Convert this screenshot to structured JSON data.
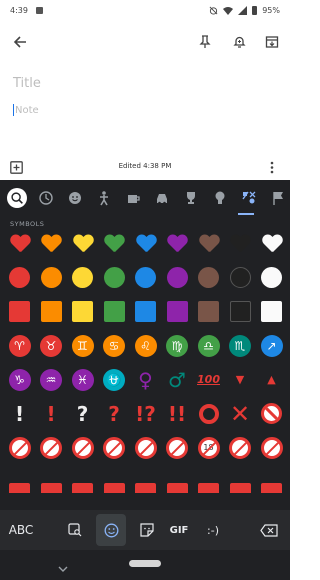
{
  "status_bar": {
    "time": "4:39",
    "battery": "95%"
  },
  "note": {
    "title_placeholder": "Title",
    "note_placeholder": "Note",
    "edited": "Edited 4:38 PM"
  },
  "keyboard": {
    "section_title": "SYMBOLS",
    "tools": {
      "abc": "ABC",
      "gif": "GIF",
      "emoticon": ":-)"
    },
    "categories": [
      "search-icon",
      "clock-icon",
      "smiley-icon",
      "person-icon",
      "coffee-icon",
      "car-icon",
      "trophy-icon",
      "bulb-icon",
      "symbols-icon",
      "flag-icon"
    ],
    "rows": [
      {
        "kind": "heart",
        "colors": [
          "#e53935",
          "#fb8c00",
          "#fdd835",
          "#43a047",
          "#1e88e5",
          "#8e24aa",
          "#795548",
          "#212121",
          "#fafafa"
        ]
      },
      {
        "kind": "circle",
        "colors": [
          "#e53935",
          "#fb8c00",
          "#fdd835",
          "#43a047",
          "#1e88e5",
          "#8e24aa",
          "#795548",
          "#212121",
          "#fafafa"
        ]
      },
      {
        "kind": "square",
        "colors": [
          "#e53935",
          "#fb8c00",
          "#fdd835",
          "#43a047",
          "#1e88e5",
          "#8e24aa",
          "#795548",
          "#212121",
          "#fafafa"
        ]
      },
      {
        "kind": "zodiac",
        "symbols": [
          "♈",
          "♉",
          "♊",
          "♋",
          "♌",
          "♍",
          "♎",
          "♏",
          "↗"
        ],
        "colors": [
          "#e53935",
          "#e53935",
          "#fb8c00",
          "#fb8c00",
          "#fb8c00",
          "#43a047",
          "#43a047",
          "#00897b",
          "#1e88e5"
        ]
      },
      {
        "kind": "zodiac",
        "symbols": [
          "♑",
          "♒",
          "♓",
          "⛎",
          "♀",
          "♂",
          "💯",
          "▼",
          "▲"
        ],
        "colors": [
          "#8e24aa",
          "#8e24aa",
          "#8e24aa",
          "#00acc1",
          "#8e24aa",
          "#00897b",
          "#e53935",
          "#e53935",
          "#e53935"
        ]
      },
      {
        "kind": "symbol",
        "symbols": [
          "!",
          "!",
          "?",
          "?",
          "!?",
          "!!",
          "O",
          "X",
          "⊘"
        ],
        "colors": [
          "#eeeeee",
          "#e53935",
          "#eeeeee",
          "#e53935",
          "#e53935",
          "#e53935",
          "#e53935",
          "#e53935",
          "#e53935"
        ]
      },
      {
        "kind": "prohibited",
        "symbols": [
          "bike",
          "smoke",
          "person",
          "litter",
          "drink",
          "phone",
          "18",
          "bell",
          "mute"
        ]
      }
    ]
  }
}
